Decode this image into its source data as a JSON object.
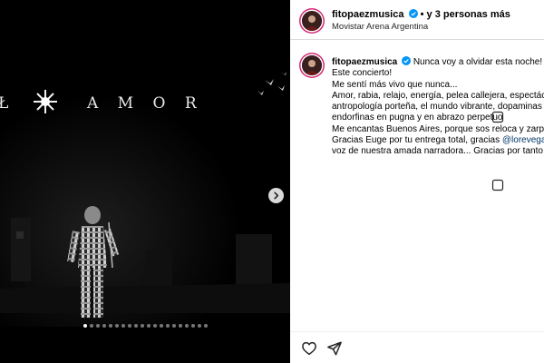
{
  "post": {
    "username": "fitopaezmusica",
    "collab_suffix": "y 3 personas más",
    "location": "Movistar Arena Argentina"
  },
  "media": {
    "sign_left": "Ł",
    "sign_right": "A M O R",
    "carousel_total": 20,
    "carousel_active_index": 0
  },
  "caption": {
    "username": "fitopaezmusica",
    "line1": "Nunca voy a olvidar esta noche!",
    "line2": "Este concierto!",
    "line3": "Me sentí más vivo que nunca...",
    "line4": "Amor, rabia, relajo, energía, pelea callejera, espectác",
    "line5": "antropología porteña, el mundo vibrante, dopaminas",
    "line6": "endorfinas en pugna y en abrazo perpetuo",
    "line7": "Me encantas Buenos Aires, porque sos reloca y zarp",
    "line8_pre": "Gracias Euge por tu entrega total, gracias ",
    "line8_mention": "@lorevega",
    "line9": "voz de nuestra amada narradora... Gracias por tanto"
  },
  "icons": {
    "like": "heart-icon",
    "share": "paper-plane-icon",
    "next": "chevron-right-icon",
    "verified": "verified-badge-icon"
  },
  "colors": {
    "accent_ring": "#d62976",
    "verified": "#0095f6",
    "mention": "#00376b"
  }
}
